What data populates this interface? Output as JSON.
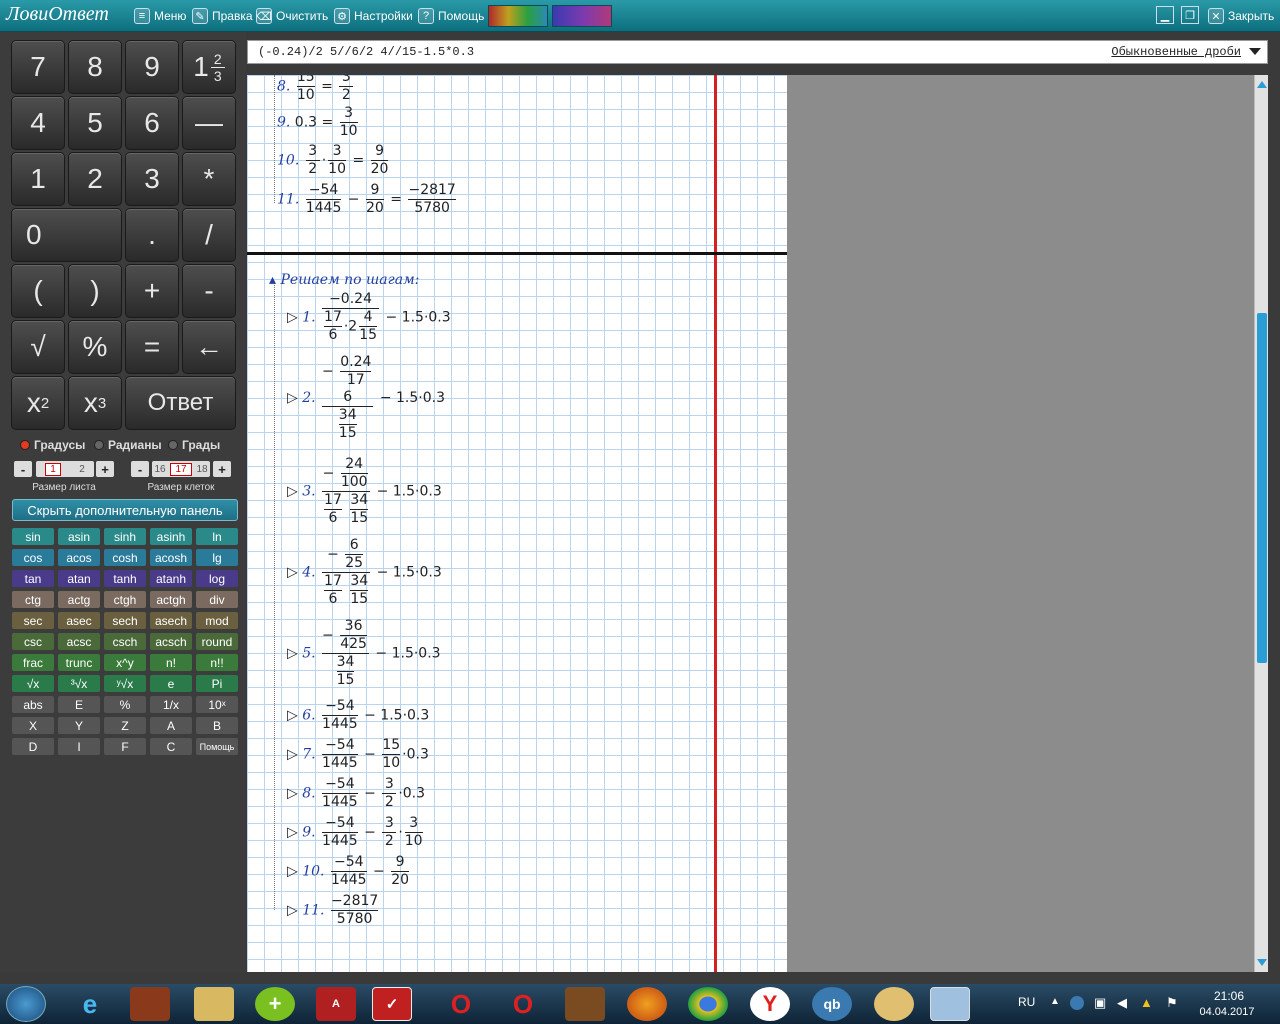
{
  "app": {
    "logo": "ЛовиОтвет",
    "colors": {
      "accent": "#1f8a9a",
      "grid": "#b9d4ee",
      "red_line": "#d42020"
    }
  },
  "toolbar": {
    "menu": "Меню",
    "edit": "Правка",
    "clear": "Очистить",
    "settings": "Настройки",
    "help": "Помощь",
    "close": "Закрыть"
  },
  "keypad": {
    "k7": "7",
    "k8": "8",
    "k9": "9",
    "mixed": "1",
    "mixed_num": "2",
    "mixed_den": "3",
    "k4": "4",
    "k5": "5",
    "k6": "6",
    "dash": "—",
    "k1": "1",
    "k2": "2",
    "k3": "3",
    "mul": "*",
    "k0": "0",
    "dot": ".",
    "div": "/",
    "lp": "(",
    "rp": ")",
    "plus": "+",
    "minus": "-",
    "sqrt": "√",
    "pct": "%",
    "eq": "=",
    "back": "←",
    "x": "x",
    "sq": "2",
    "cube": "3",
    "answer": "Ответ"
  },
  "angle": {
    "deg": "Градусы",
    "rad": "Радианы",
    "grad": "Грады"
  },
  "sheet": {
    "minus": "-",
    "plus": "+",
    "v1": "1",
    "v2": "2",
    "caption": "Размер листа"
  },
  "cells": {
    "minus": "-",
    "plus": "+",
    "v1": "16",
    "v2": "17",
    "v3": "18",
    "caption": "Размер клеток"
  },
  "panel_toggle": "Скрыть дополнительную панель",
  "functions": [
    [
      "sin",
      "asin",
      "sinh",
      "asinh",
      "ln"
    ],
    [
      "cos",
      "acos",
      "cosh",
      "acosh",
      "lg"
    ],
    [
      "tan",
      "atan",
      "tanh",
      "atanh",
      "log"
    ],
    [
      "ctg",
      "actg",
      "ctgh",
      "actgh",
      "div"
    ],
    [
      "sec",
      "asec",
      "sech",
      "asech",
      "mod"
    ],
    [
      "csc",
      "acsc",
      "csch",
      "acsch",
      "round"
    ],
    [
      "frac",
      "trunc",
      "x^y",
      "n!",
      "n!!"
    ],
    [
      "√x",
      "³√x",
      "ʸ√x",
      "e",
      "Pi"
    ],
    [
      "abs",
      "E",
      "%",
      "1/x",
      "10ˣ"
    ],
    [
      "X",
      "Y",
      "Z",
      "A",
      "B"
    ],
    [
      "D",
      "I",
      "F",
      "C",
      "Помощь"
    ]
  ],
  "input": {
    "expression": "(-0.24)/2 5//6/2 4//15-1.5*0.3",
    "mode": "Обыкновенные дроби"
  },
  "solution": {
    "upper": [
      {
        "n": "8.",
        "tex": "15/10 = 3/2"
      },
      {
        "n": "9.",
        "tex": "0.3 = 3/10"
      },
      {
        "n": "10.",
        "tex": "3/2 · 3/10 = 9/20"
      },
      {
        "n": "11.",
        "tex": "-54/1445 - 9/20 = -2817/5780"
      }
    ],
    "heading": "Решаем по шагам:",
    "steps": [
      {
        "n": "1."
      },
      {
        "n": "2."
      },
      {
        "n": "3."
      },
      {
        "n": "4."
      },
      {
        "n": "5."
      },
      {
        "n": "6."
      },
      {
        "n": "7."
      },
      {
        "n": "8."
      },
      {
        "n": "9."
      },
      {
        "n": "10."
      },
      {
        "n": "11."
      }
    ]
  },
  "tray": {
    "lang": "RU",
    "time": "21:06",
    "date": "04.04.2017"
  }
}
